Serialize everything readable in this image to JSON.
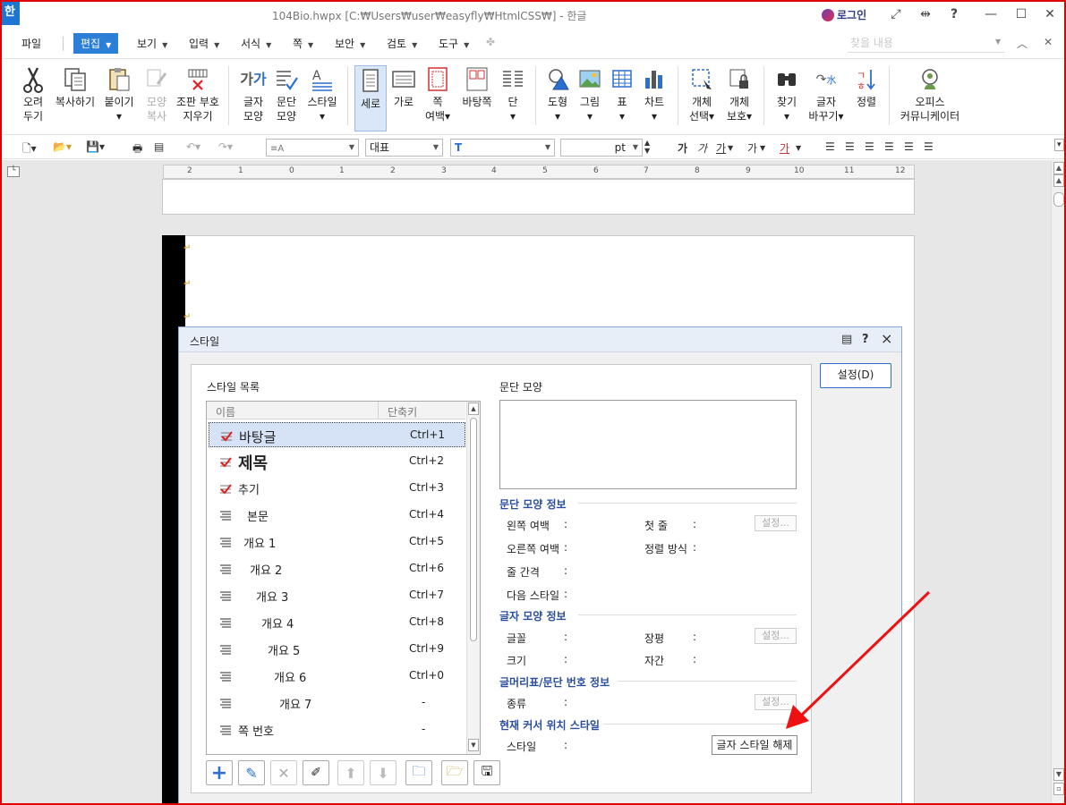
{
  "title_bar": {
    "app_logo": "한",
    "window_title": "104Bio.hwpx [C:₩Users₩user₩easyfly₩HtmlCSS₩] - 한글",
    "login": "로그인"
  },
  "menu": {
    "items": [
      "파일",
      "편집",
      "보기",
      "입력",
      "서식",
      "쪽",
      "보안",
      "검토",
      "도구"
    ],
    "active": "편집",
    "search_placeholder": "찾을 내용"
  },
  "ribbon": {
    "buttons": [
      {
        "line1": "오려",
        "line2": "두기",
        "icon": "scissors-icon"
      },
      {
        "line1": "복사하기",
        "line2": "",
        "icon": "copy-icon"
      },
      {
        "line1": "붙이기",
        "line2": "▾",
        "icon": "paste-icon"
      },
      {
        "line1": "모양",
        "line2": "복사",
        "icon": "format-painter-icon"
      },
      {
        "line1": "조판 부호",
        "line2": "지우기",
        "icon": "clear-format-icon"
      },
      {
        "line1": "글자",
        "line2": "모양",
        "icon": "char-shape-icon"
      },
      {
        "line1": "문단",
        "line2": "모양",
        "icon": "para-shape-icon"
      },
      {
        "line1": "스타일",
        "line2": "▾",
        "icon": "style-icon"
      },
      {
        "line1": "세로",
        "line2": "",
        "icon": "portrait-icon"
      },
      {
        "line1": "가로",
        "line2": "",
        "icon": "landscape-icon"
      },
      {
        "line1": "쪽",
        "line2": "여백▾",
        "icon": "margin-icon"
      },
      {
        "line1": "바탕쪽",
        "line2": "",
        "icon": "master-page-icon"
      },
      {
        "line1": "단",
        "line2": "▾",
        "icon": "columns-icon"
      },
      {
        "line1": "도형",
        "line2": "▾",
        "icon": "shape-icon"
      },
      {
        "line1": "그림",
        "line2": "▾",
        "icon": "picture-icon"
      },
      {
        "line1": "표",
        "line2": "▾",
        "icon": "table-icon"
      },
      {
        "line1": "차트",
        "line2": "▾",
        "icon": "chart-icon"
      },
      {
        "line1": "개체",
        "line2": "선택▾",
        "icon": "select-object-icon"
      },
      {
        "line1": "개체",
        "line2": "보호▾",
        "icon": "protect-object-icon"
      },
      {
        "line1": "찾기",
        "line2": "▾",
        "icon": "find-icon"
      },
      {
        "line1": "글자",
        "line2": "바꾸기▾",
        "icon": "replace-icon"
      },
      {
        "line1": "정렬",
        "line2": "",
        "icon": "sort-icon"
      },
      {
        "line1": "오피스",
        "line2": "커뮤니케이터",
        "icon": "communicator-icon"
      }
    ]
  },
  "format_bar": {
    "style_value": "",
    "lang_value": "대표",
    "font_value": "",
    "size_unit": "pt",
    "char_buttons": [
      "가",
      "가",
      "가",
      "가",
      "가"
    ]
  },
  "ruler_ticks": [
    "2",
    "1",
    "0",
    "1",
    "2",
    "3",
    "4",
    "5",
    "6",
    "7",
    "8",
    "9",
    "10",
    "11",
    "12"
  ],
  "dialog": {
    "title": "스타일",
    "help": "?",
    "close": "×",
    "setting_button": "설정(D)",
    "list_title": "스타일 목록",
    "col_name": "이름",
    "col_key": "단축키",
    "styles": [
      {
        "name": "바탕글",
        "key": "Ctrl+1",
        "type": "check",
        "indent": 0,
        "bold": false,
        "size": 15
      },
      {
        "name": "제목",
        "key": "Ctrl+2",
        "type": "check",
        "indent": 0,
        "bold": true,
        "size": 18
      },
      {
        "name": "추기",
        "key": "Ctrl+3",
        "type": "check",
        "indent": 0,
        "bold": false,
        "size": 13
      },
      {
        "name": "본문",
        "key": "Ctrl+4",
        "type": "para",
        "indent": 10,
        "bold": false,
        "size": 13
      },
      {
        "name": "개요  1",
        "key": "Ctrl+5",
        "type": "para",
        "indent": 6,
        "bold": false,
        "size": 13
      },
      {
        "name": "개요  2",
        "key": "Ctrl+6",
        "type": "para",
        "indent": 13,
        "bold": false,
        "size": 13
      },
      {
        "name": "개요  3",
        "key": "Ctrl+7",
        "type": "para",
        "indent": 20,
        "bold": false,
        "size": 13
      },
      {
        "name": "개요  4",
        "key": "Ctrl+8",
        "type": "para",
        "indent": 26,
        "bold": false,
        "size": 13
      },
      {
        "name": "개요  5",
        "key": "Ctrl+9",
        "type": "para",
        "indent": 33,
        "bold": false,
        "size": 13
      },
      {
        "name": "개요  6",
        "key": "Ctrl+0",
        "type": "para",
        "indent": 40,
        "bold": false,
        "size": 13
      },
      {
        "name": "개요  7",
        "key": "-",
        "type": "para",
        "indent": 46,
        "bold": false,
        "size": 13
      },
      {
        "name": "쪽 번호",
        "key": "-",
        "type": "para",
        "indent": 0,
        "bold": false,
        "size": 13
      }
    ],
    "selected_style": "바탕글",
    "para_shape_title": "문단 모양",
    "sections": {
      "para_info": "문단 모양 정보",
      "char_info": "글자 모양 정보",
      "bullet_info": "글머리표/문단 번호 정보",
      "cursor_style": "현재 커서 위치 스타일"
    },
    "labels": {
      "left_margin": "왼쪽 여백",
      "first_line": "첫 줄",
      "right_margin": "오른쪽 여백",
      "align": "정렬 방식",
      "line_spacing": "줄 간격",
      "next_style": "다음 스타일",
      "font": "글꼴",
      "width": "장평",
      "size": "크기",
      "spacing": "자간",
      "kind": "종류",
      "style": "스타일"
    },
    "colon": ":",
    "detail_button": "설정...",
    "clear_char_style_button": "글자 스타일 해제"
  }
}
